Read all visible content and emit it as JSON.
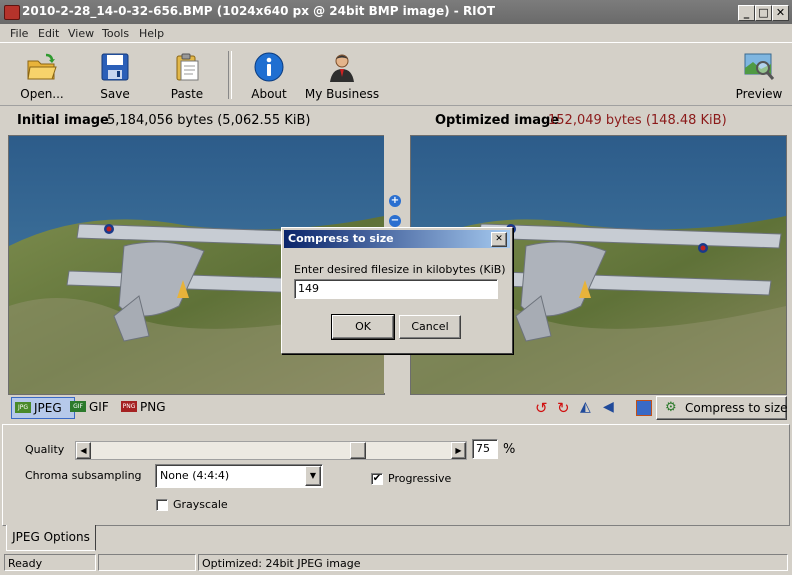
{
  "window": {
    "title": "2010-2-28_14-0-32-656.BMP (1024x640 px @ 24bit BMP image) - RIOT"
  },
  "menu": [
    "File",
    "Edit",
    "View",
    "Tools",
    "Help"
  ],
  "toolbar": {
    "open": "Open...",
    "save": "Save",
    "paste": "Paste",
    "about": "About",
    "business": "My Business",
    "preview": "Preview"
  },
  "initial": {
    "label": "Initial image",
    "size": "5,184,056 bytes (5,062.55 KiB)"
  },
  "optimized": {
    "label": "Optimized image",
    "size": "152,049 bytes (148.48 KiB)",
    "size_color": "#8b1a1a"
  },
  "formats": [
    "JPEG",
    "GIF",
    "PNG"
  ],
  "format_icons": [
    "JPG",
    "GIF",
    "PNG"
  ],
  "compress_button": "Compress to size",
  "options": {
    "quality_label": "Quality",
    "quality_value": "75",
    "quality_fraction": 0.75,
    "percent": "%",
    "chroma_label": "Chroma subsampling",
    "chroma_value": "None (4:4:4)",
    "progressive_label": "Progressive",
    "progressive_checked": true,
    "grayscale_label": "Grayscale",
    "grayscale_checked": false
  },
  "options_tab": "JPEG Options",
  "dialog": {
    "title": "Compress to size",
    "prompt": "Enter desired filesize in kilobytes (KiB)",
    "value": "149",
    "ok": "OK",
    "cancel": "Cancel",
    "close": "✕"
  },
  "status": {
    "left": "Ready",
    "middle": "",
    "right": "Optimized: 24bit JPEG image"
  }
}
